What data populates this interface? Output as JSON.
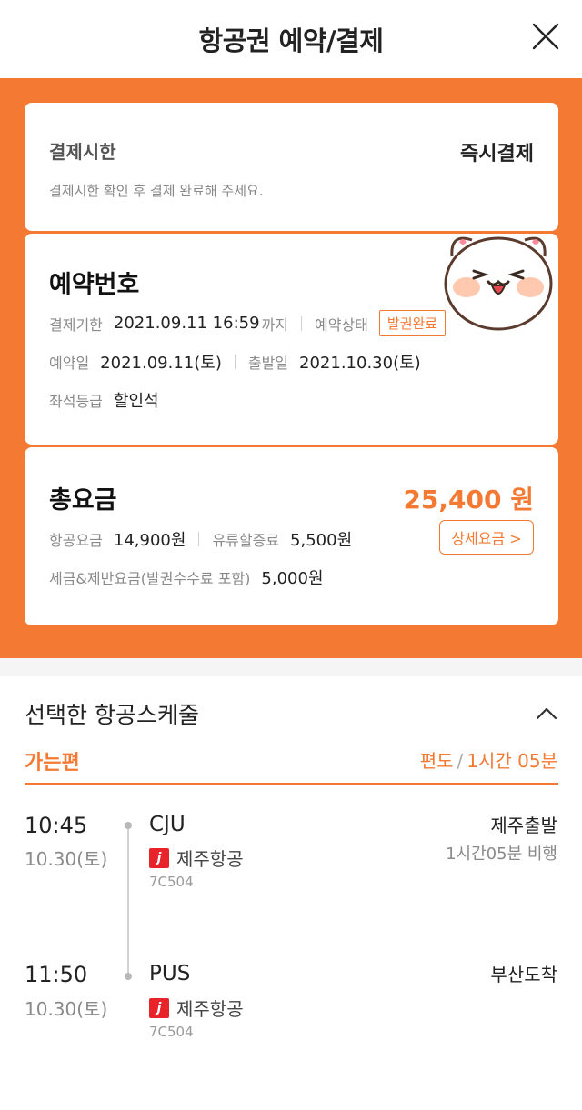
{
  "header": {
    "title": "항공권 예약/결제"
  },
  "deadline": {
    "label": "결제시한",
    "value": "즉시결제",
    "hint": "결제시한 확인 후 결제 완료해 주세요."
  },
  "reservation": {
    "title": "예약번호",
    "pay_deadline_label": "결제기한",
    "pay_deadline_value": "2021.09.11 16:59",
    "pay_deadline_suffix": "까지",
    "status_label": "예약상태",
    "status_value": "발권완료",
    "booked_label": "예약일",
    "booked_value": "2021.09.11(토)",
    "depart_label": "출발일",
    "depart_value": "2021.10.30(토)",
    "seat_label": "좌석등급",
    "seat_value": "할인석"
  },
  "fare": {
    "title": "총요금",
    "total": "25,400 원",
    "air_label": "항공요금",
    "air_value": "14,900원",
    "fuel_label": "유류할증료",
    "fuel_value": "5,500원",
    "tax_label": "세금&제반요금(발권수수료 포함)",
    "tax_value": "5,000원",
    "detail_button": "상세요금 >"
  },
  "schedule": {
    "title": "선택한 항공스케줄",
    "leg_label": "가는편",
    "trip_type": "편도",
    "duration": "1시간 05분",
    "departure": {
      "time": "10:45",
      "date": "10.30(토)",
      "airport": "CJU",
      "airline": "제주항공",
      "airline_logo": "j",
      "flight_no": "7C504",
      "status": "제주출발",
      "flight_time": "1시간05분 비행"
    },
    "arrival": {
      "time": "11:50",
      "date": "10.30(토)",
      "airport": "PUS",
      "airline": "제주항공",
      "airline_logo": "j",
      "flight_no": "7C504",
      "status": "부산도착"
    }
  },
  "icons": {
    "close": "close-icon",
    "collapse": "chevron-up-icon",
    "sticker": "cat-sticker"
  },
  "colors": {
    "accent": "#f47a33",
    "airline_red": "#e8242a"
  }
}
